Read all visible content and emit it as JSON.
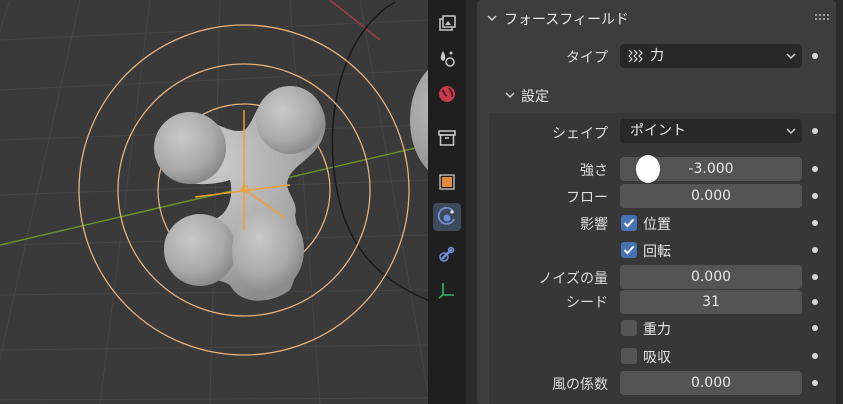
{
  "panel": {
    "title": "フォースフィールド",
    "type_label": "タイプ",
    "type_value": "力",
    "settings_title": "設定"
  },
  "settings": {
    "shape_label": "シェイプ",
    "shape_value": "ポイント",
    "strength_label": "強さ",
    "strength_value": "-3.000",
    "flow_label": "フロー",
    "flow_value": "0.000",
    "affect_label": "影響",
    "affect_location_label": "位置",
    "affect_location_checked": true,
    "affect_rotation_label": "回転",
    "affect_rotation_checked": true,
    "noise_label": "ノイズの量",
    "noise_value": "0.000",
    "seed_label": "シード",
    "seed_value": "31",
    "gravity_label": "重力",
    "gravity_checked": false,
    "absorption_label": "吸収",
    "absorption_checked": false,
    "wind_factor_label": "風の係数",
    "wind_factor_value": "0.000"
  },
  "tabs": [
    {
      "name": "render-tab",
      "icon": "image-stack-icon"
    },
    {
      "name": "particles-tab",
      "icon": "particles-icon"
    },
    {
      "name": "world-tab",
      "icon": "world-icon"
    },
    {
      "name": "collection-tab",
      "icon": "archive-box-icon"
    },
    {
      "name": "object-tab",
      "icon": "object-square-icon"
    },
    {
      "name": "physics-tab",
      "icon": "physics-icon",
      "active": true
    },
    {
      "name": "constraints-tab",
      "icon": "constraint-icon"
    },
    {
      "name": "data-tab",
      "icon": "empty-axes-icon"
    }
  ],
  "colors": {
    "accent_blue": "#4772b3",
    "field_bg": "#545454",
    "panel_bg": "#3d3d3d",
    "viewport_bg": "#3a3a3a",
    "selection_orange": "#f0a030"
  }
}
